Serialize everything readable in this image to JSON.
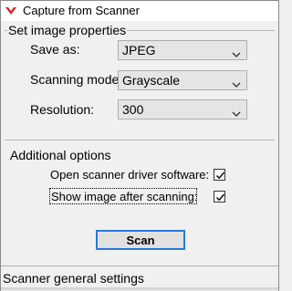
{
  "window": {
    "title": "Capture from Scanner",
    "icon": "scanner-app-icon"
  },
  "image_properties": {
    "group_label": "Set image properties",
    "save_as": {
      "label": "Save as:",
      "value": "JPEG"
    },
    "scanning_mode": {
      "label": "Scanning mode:",
      "value": "Grayscale"
    },
    "resolution": {
      "label": "Resolution:",
      "value": "300"
    }
  },
  "additional_options": {
    "group_label": "Additional options",
    "open_driver": {
      "label": "Open scanner driver software:",
      "checked": true
    },
    "show_image": {
      "label": "Show image after scanning:",
      "checked": true
    }
  },
  "scan_button": {
    "label": "Scan"
  },
  "status": {
    "text": "Scanner general settings"
  },
  "colors": {
    "accent": "#2979d6",
    "icon_red": "#d8232a"
  }
}
